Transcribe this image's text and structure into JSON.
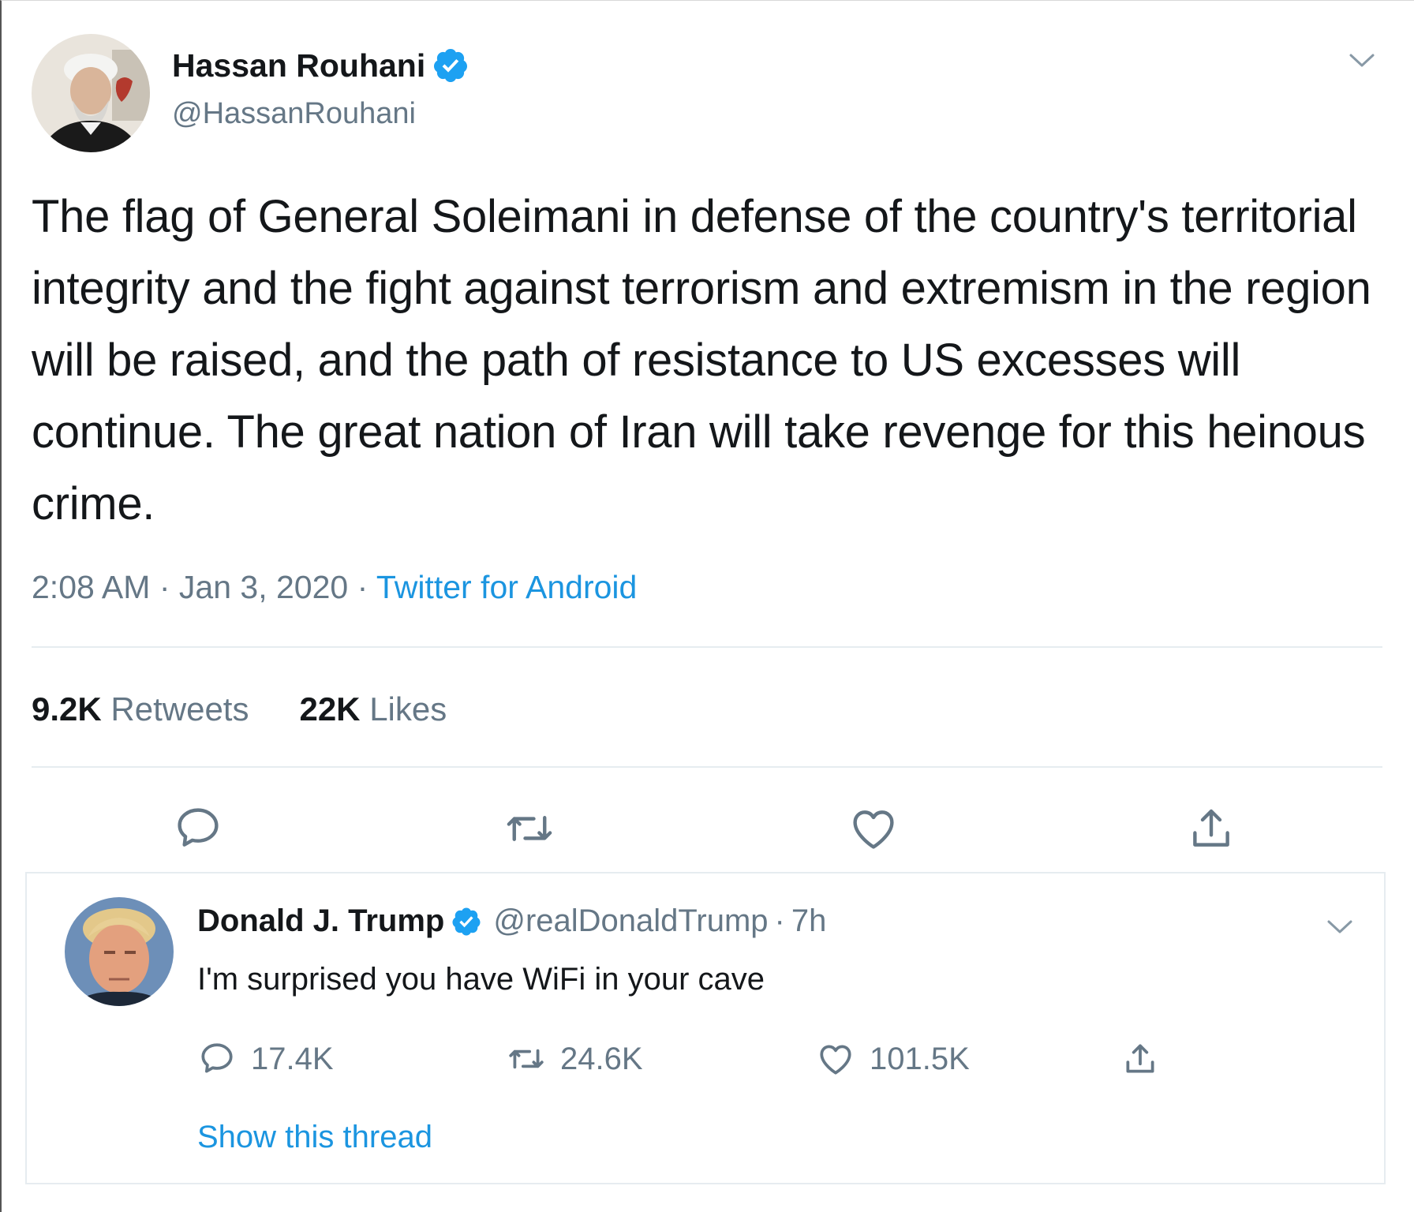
{
  "main_tweet": {
    "display_name": "Hassan Rouhani",
    "handle": "@HassanRouhani",
    "text": "The flag of General Soleimani in defense of the country's territorial integrity and the fight against terrorism and extremism in the region will be raised, and the path of resistance to US excesses will continue. The great nation of Iran will take revenge for this heinous crime.",
    "time": "2:08 AM",
    "separator": "·",
    "date": "Jan 3, 2020",
    "source": "Twitter for Android",
    "retweets_count": "9.2K",
    "retweets_label": "Retweets",
    "likes_count": "22K",
    "likes_label": "Likes"
  },
  "reply_tweet": {
    "display_name": "Donald J. Trump",
    "handle": "@realDonaldTrump",
    "separator": "·",
    "age": "7h",
    "text": "I'm surprised you have WiFi in your cave",
    "replies_count": "17.4K",
    "retweets_count": "24.6K",
    "likes_count": "101.5K",
    "show_thread": "Show this thread"
  },
  "colors": {
    "accent": "#1b95e0",
    "secondary_text": "#657786",
    "primary_text": "#14171a",
    "divider": "#e6ecf0"
  },
  "icons": [
    "verified-badge-icon",
    "chevron-down-icon",
    "reply-icon",
    "retweet-icon",
    "like-icon",
    "share-icon"
  ]
}
